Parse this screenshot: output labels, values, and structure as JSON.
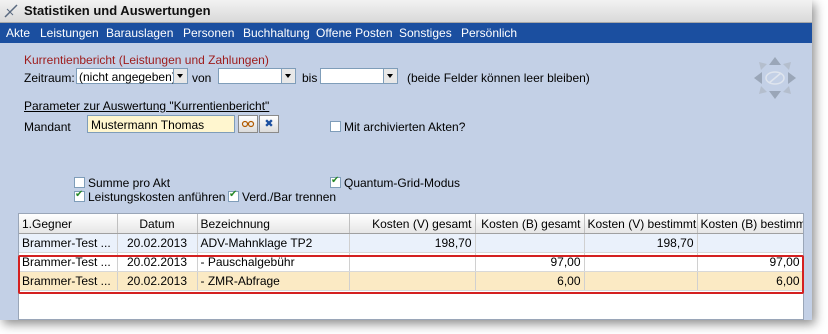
{
  "window": {
    "title": "Statistiken und Auswertungen"
  },
  "menu": [
    "Akte",
    "Leistungen",
    "Barauslagen",
    "Personen",
    "Buchhaltung",
    "Offene Posten",
    "Sonstiges",
    "Persönlich"
  ],
  "report": {
    "section_title": "Kurrentienbericht (Leistungen und Zahlungen)",
    "zeitraum_label": "Zeitraum:",
    "zeitraum_value": "(nicht angegeben)",
    "von_label": "von",
    "von_value": "",
    "bis_label": "bis",
    "bis_value": "",
    "hint": "(beide Felder können leer bleiben)"
  },
  "params": {
    "title": "Parameter zur Auswertung \"Kurrentienbericht\"",
    "mandant_label": "Mandant",
    "mandant_value": "Mustermann Thomas",
    "archived_label": "Mit archivierten Akten?",
    "archived_checked": false
  },
  "options": {
    "summe_label": "Summe pro Akt",
    "summe_checked": false,
    "quantum_label": "Quantum-Grid-Modus",
    "quantum_checked": true,
    "leistungskosten_label": "Leistungskosten anführen",
    "leistungskosten_checked": true,
    "verd_label": "Verd./Bar trennen",
    "verd_checked": true
  },
  "grid": {
    "columns": [
      "1.Gegner",
      "Datum",
      "Bezeichnung",
      "Kosten (V) gesamt",
      "Kosten (B) gesamt",
      "Kosten (V) bestimmt",
      "Kosten (B) bestimmt"
    ],
    "rows": [
      [
        "Brammer-Test ...",
        "20.02.2013",
        "ADV-Mahnklage TP2",
        "198,70",
        "",
        "198,70",
        ""
      ],
      [
        "Brammer-Test ...",
        "20.02.2013",
        "- Pauschalgebühr",
        "",
        "97,00",
        "",
        "97,00"
      ],
      [
        "Brammer-Test ...",
        "20.02.2013",
        "- ZMR-Abfrage",
        "",
        "6,00",
        "",
        "6,00"
      ]
    ]
  },
  "colors": {
    "menubar": "#1b4fa0",
    "section_title": "#9e1b1b",
    "highlight": "#d42020"
  }
}
